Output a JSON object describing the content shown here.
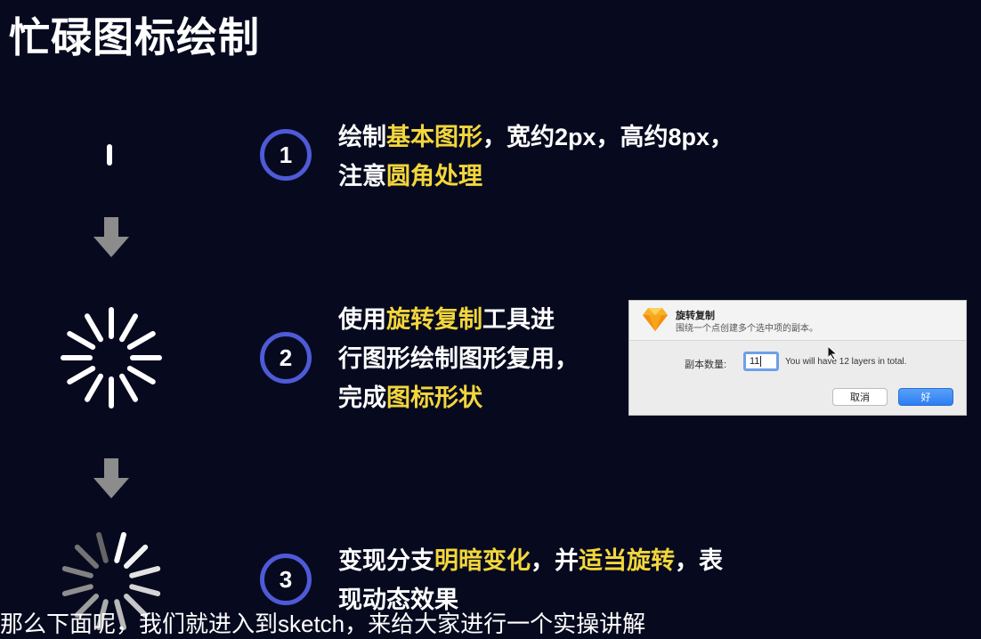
{
  "title": "忙碌图标绘制",
  "steps": [
    {
      "number": "1",
      "lines": [
        [
          {
            "t": "绘制",
            "hl": false
          },
          {
            "t": "基本图形",
            "hl": true
          },
          {
            "t": "，宽约2px，高约8px，",
            "hl": false
          }
        ],
        [
          {
            "t": "注意",
            "hl": false
          },
          {
            "t": "圆角处理",
            "hl": true
          }
        ]
      ]
    },
    {
      "number": "2",
      "lines": [
        [
          {
            "t": "使用",
            "hl": false
          },
          {
            "t": "旋转复制",
            "hl": true
          },
          {
            "t": "工具进",
            "hl": false
          }
        ],
        [
          {
            "t": "行图形绘制图形复用，",
            "hl": false
          }
        ],
        [
          {
            "t": "完成",
            "hl": false
          },
          {
            "t": "图标形状",
            "hl": true
          }
        ]
      ]
    },
    {
      "number": "3",
      "lines": [
        [
          {
            "t": "变现分支",
            "hl": false
          },
          {
            "t": "明暗变化",
            "hl": true
          },
          {
            "t": "，并",
            "hl": false
          },
          {
            "t": "适当旋转",
            "hl": true
          },
          {
            "t": "，表",
            "hl": false
          }
        ],
        [
          {
            "t": "现动态效果",
            "hl": false
          }
        ]
      ]
    }
  ],
  "dialog": {
    "app_icon": "sketch-diamond-icon",
    "title": "旋转复制",
    "subtitle": "围绕一个点创建多个选中项的副本。",
    "label": "副本数量:",
    "input_value": "11",
    "hint": "You will have 12 layers in total.",
    "cancel_label": "取消",
    "ok_label": "好"
  },
  "subtitle": "那么下面呢，我们就进入到sketch，来给大家进行一个实操讲解",
  "colors": {
    "background": "#070a1f",
    "highlight": "#f3d63b",
    "step_ring": "#4f5ad8",
    "arrow": "#8c8c8c"
  }
}
